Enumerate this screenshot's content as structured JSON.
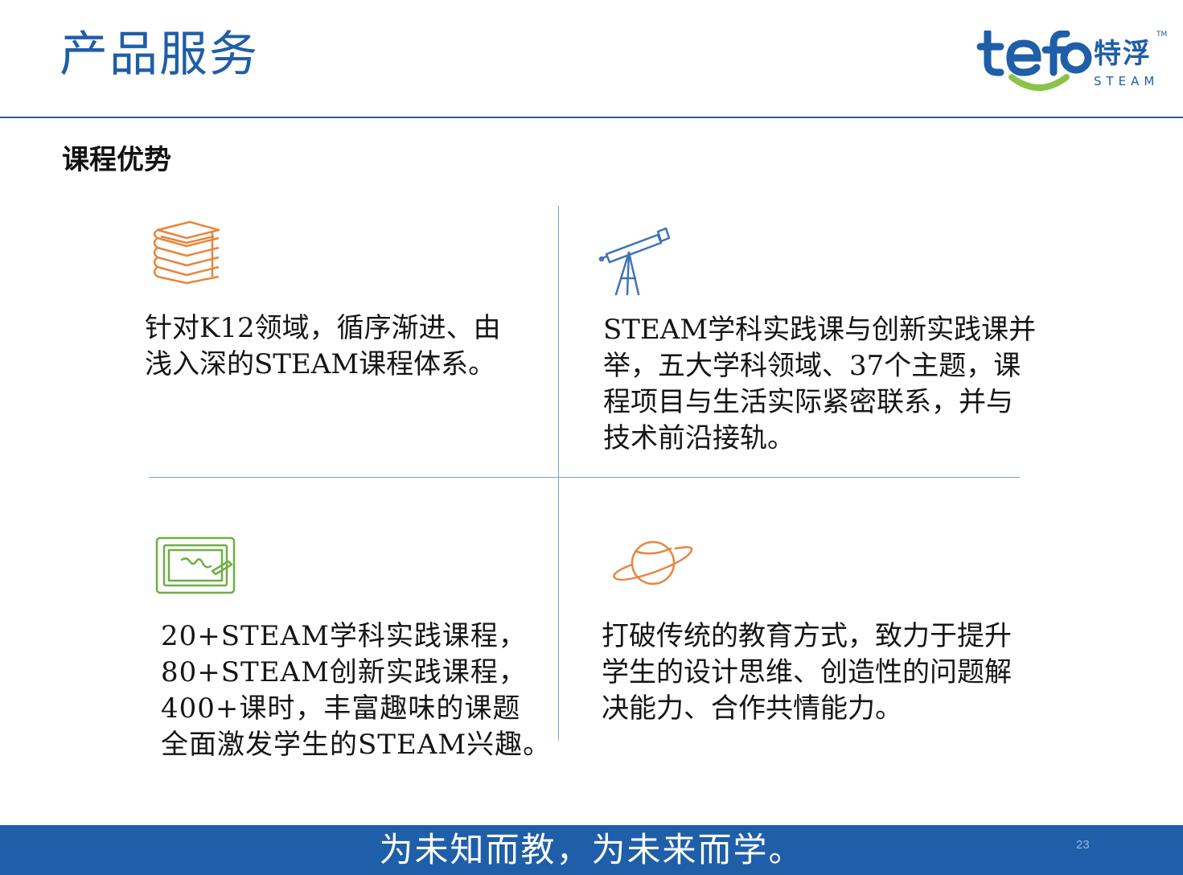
{
  "header": {
    "title": "产品服务",
    "logo": {
      "wordmark": "tefo",
      "chinese": "特浮",
      "sub": "STEAM",
      "tm": "TM"
    }
  },
  "section": {
    "title": "课程优势"
  },
  "quadrants": [
    {
      "icon": "books-icon",
      "color": "#e8853d",
      "lines": [
        "针对K12领域，循序渐进、由",
        "浅入深的STEAM课程体系。"
      ]
    },
    {
      "icon": "telescope-icon",
      "color": "#3f73b8",
      "lines": [
        "STEAM学科实践课与创新实践课并",
        "举，五大学科领域、37个主题，课",
        "程项目与生活实际紧密联系，并与",
        "技术前沿接轨。"
      ]
    },
    {
      "icon": "drawing-tablet-icon",
      "color": "#6fae45",
      "lines": [
        "20+STEAM学科实践课程，",
        "80+STEAM创新实践课程，",
        "400+课时，丰富趣味的课题",
        "全面激发学生的STEAM兴趣。"
      ]
    },
    {
      "icon": "planet-icon",
      "color": "#e8853d",
      "lines": [
        "打破传统的教育方式，致力于提升",
        "学生的设计思维、创造性的问题解",
        "决能力、合作共情能力。"
      ]
    }
  ],
  "footer": {
    "slogan": "为未知而教，为未来而学。",
    "page_number": "23",
    "color": "#1f5ea8"
  }
}
